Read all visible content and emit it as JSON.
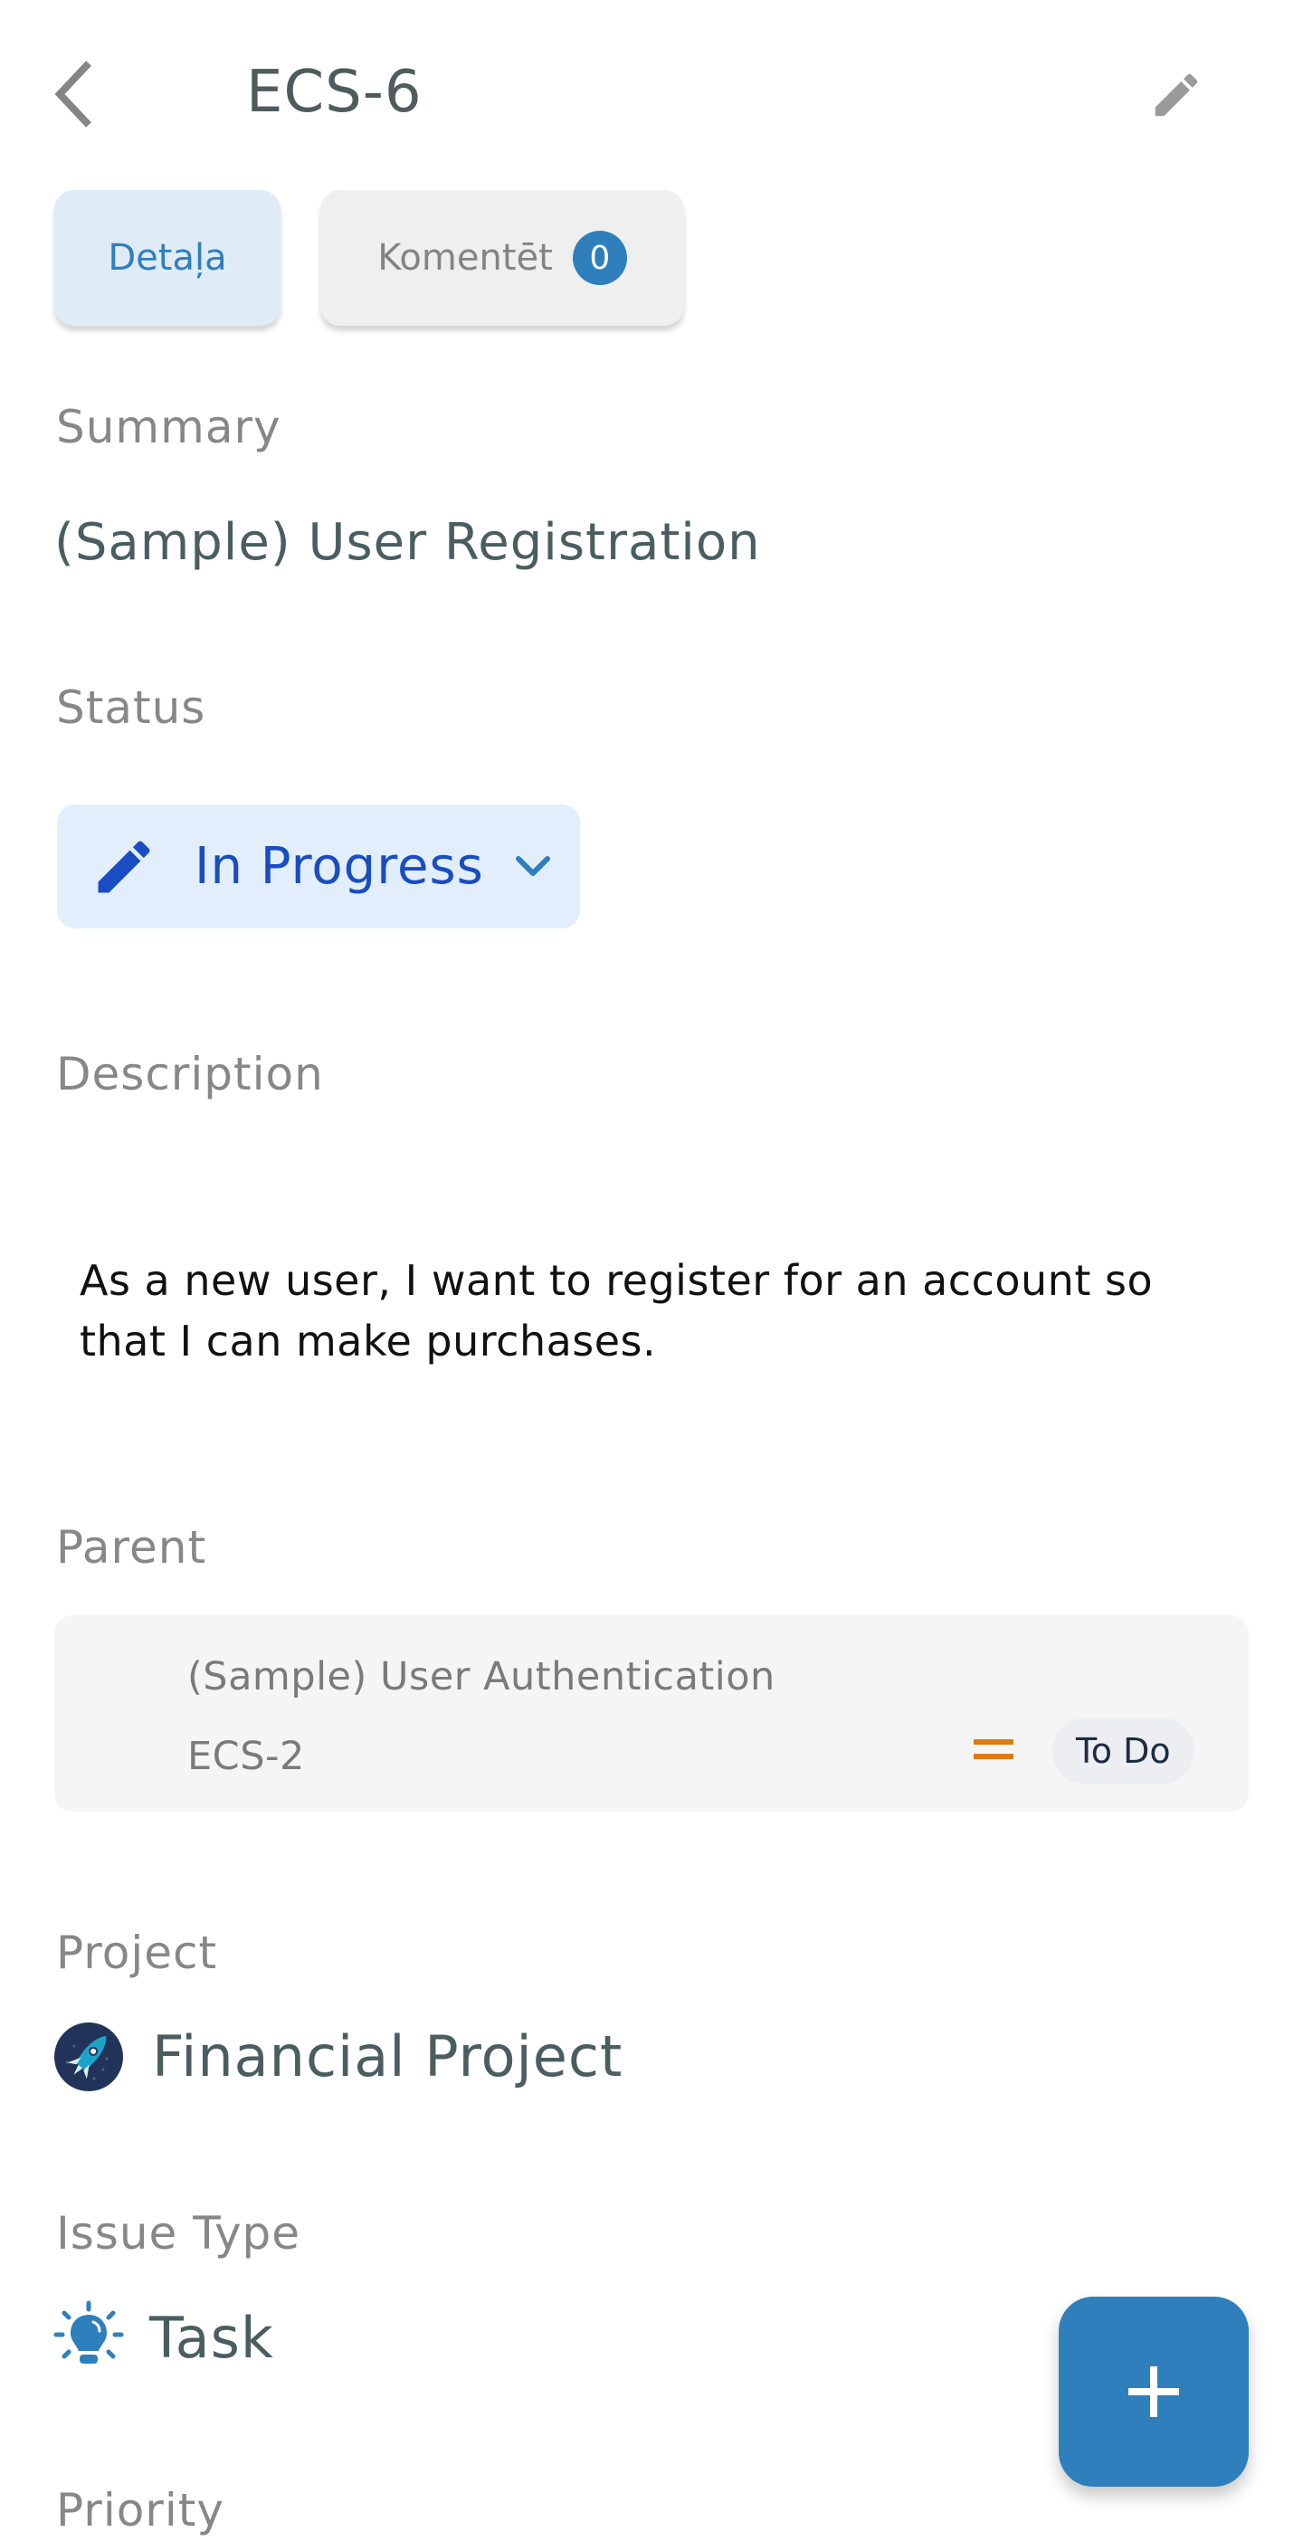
{
  "header": {
    "title": "ECS-6",
    "back_icon": "chevron-left-icon",
    "edit_icon": "pencil-icon"
  },
  "tabs": [
    {
      "label": "Detaļa",
      "active": true
    },
    {
      "label": "Komentēt",
      "badge_count": "0",
      "active": false
    }
  ],
  "fields": {
    "summary": {
      "label": "Summary",
      "value": "(Sample) User Registration"
    },
    "status": {
      "label": "Status",
      "value": "In Progress",
      "icon": "pencil-icon",
      "dropdown_icon": "chevron-down-icon"
    },
    "description": {
      "label": "Description",
      "value": "As a new user, I want to register for an account so that I can make purchases."
    },
    "parent": {
      "label": "Parent",
      "title": "(Sample) User Authentication",
      "key": "ECS-2",
      "priority_icon": "priority-medium-icon",
      "status": "To Do"
    },
    "project": {
      "label": "Project",
      "value": "Financial Project",
      "icon": "rocket-avatar-icon"
    },
    "issue_type": {
      "label": "Issue Type",
      "value": "Task",
      "icon": "lightbulb-icon"
    },
    "priority": {
      "label": "Priority"
    }
  },
  "fab": {
    "icon": "plus-icon"
  },
  "colors": {
    "accent": "#2F7FBD",
    "status_text": "#1A4DC1",
    "status_bg": "#E3EEFC",
    "priority_medium": "#E07A10"
  }
}
